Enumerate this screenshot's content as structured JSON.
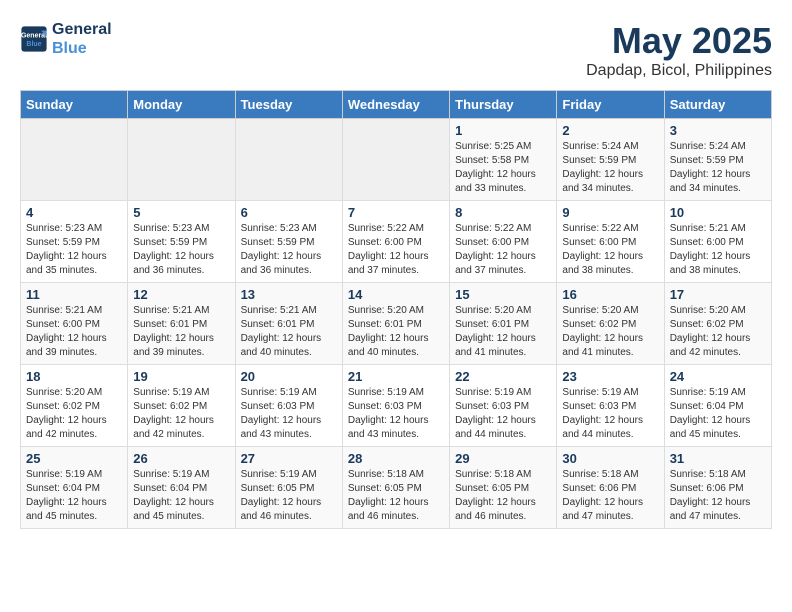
{
  "header": {
    "logo_line1": "General",
    "logo_line2": "Blue",
    "title": "May 2025",
    "subtitle": "Dapdap, Bicol, Philippines"
  },
  "weekdays": [
    "Sunday",
    "Monday",
    "Tuesday",
    "Wednesday",
    "Thursday",
    "Friday",
    "Saturday"
  ],
  "weeks": [
    [
      {
        "day": "",
        "info": ""
      },
      {
        "day": "",
        "info": ""
      },
      {
        "day": "",
        "info": ""
      },
      {
        "day": "",
        "info": ""
      },
      {
        "day": "1",
        "info": "Sunrise: 5:25 AM\nSunset: 5:58 PM\nDaylight: 12 hours\nand 33 minutes."
      },
      {
        "day": "2",
        "info": "Sunrise: 5:24 AM\nSunset: 5:59 PM\nDaylight: 12 hours\nand 34 minutes."
      },
      {
        "day": "3",
        "info": "Sunrise: 5:24 AM\nSunset: 5:59 PM\nDaylight: 12 hours\nand 34 minutes."
      }
    ],
    [
      {
        "day": "4",
        "info": "Sunrise: 5:23 AM\nSunset: 5:59 PM\nDaylight: 12 hours\nand 35 minutes."
      },
      {
        "day": "5",
        "info": "Sunrise: 5:23 AM\nSunset: 5:59 PM\nDaylight: 12 hours\nand 36 minutes."
      },
      {
        "day": "6",
        "info": "Sunrise: 5:23 AM\nSunset: 5:59 PM\nDaylight: 12 hours\nand 36 minutes."
      },
      {
        "day": "7",
        "info": "Sunrise: 5:22 AM\nSunset: 6:00 PM\nDaylight: 12 hours\nand 37 minutes."
      },
      {
        "day": "8",
        "info": "Sunrise: 5:22 AM\nSunset: 6:00 PM\nDaylight: 12 hours\nand 37 minutes."
      },
      {
        "day": "9",
        "info": "Sunrise: 5:22 AM\nSunset: 6:00 PM\nDaylight: 12 hours\nand 38 minutes."
      },
      {
        "day": "10",
        "info": "Sunrise: 5:21 AM\nSunset: 6:00 PM\nDaylight: 12 hours\nand 38 minutes."
      }
    ],
    [
      {
        "day": "11",
        "info": "Sunrise: 5:21 AM\nSunset: 6:00 PM\nDaylight: 12 hours\nand 39 minutes."
      },
      {
        "day": "12",
        "info": "Sunrise: 5:21 AM\nSunset: 6:01 PM\nDaylight: 12 hours\nand 39 minutes."
      },
      {
        "day": "13",
        "info": "Sunrise: 5:21 AM\nSunset: 6:01 PM\nDaylight: 12 hours\nand 40 minutes."
      },
      {
        "day": "14",
        "info": "Sunrise: 5:20 AM\nSunset: 6:01 PM\nDaylight: 12 hours\nand 40 minutes."
      },
      {
        "day": "15",
        "info": "Sunrise: 5:20 AM\nSunset: 6:01 PM\nDaylight: 12 hours\nand 41 minutes."
      },
      {
        "day": "16",
        "info": "Sunrise: 5:20 AM\nSunset: 6:02 PM\nDaylight: 12 hours\nand 41 minutes."
      },
      {
        "day": "17",
        "info": "Sunrise: 5:20 AM\nSunset: 6:02 PM\nDaylight: 12 hours\nand 42 minutes."
      }
    ],
    [
      {
        "day": "18",
        "info": "Sunrise: 5:20 AM\nSunset: 6:02 PM\nDaylight: 12 hours\nand 42 minutes."
      },
      {
        "day": "19",
        "info": "Sunrise: 5:19 AM\nSunset: 6:02 PM\nDaylight: 12 hours\nand 42 minutes."
      },
      {
        "day": "20",
        "info": "Sunrise: 5:19 AM\nSunset: 6:03 PM\nDaylight: 12 hours\nand 43 minutes."
      },
      {
        "day": "21",
        "info": "Sunrise: 5:19 AM\nSunset: 6:03 PM\nDaylight: 12 hours\nand 43 minutes."
      },
      {
        "day": "22",
        "info": "Sunrise: 5:19 AM\nSunset: 6:03 PM\nDaylight: 12 hours\nand 44 minutes."
      },
      {
        "day": "23",
        "info": "Sunrise: 5:19 AM\nSunset: 6:03 PM\nDaylight: 12 hours\nand 44 minutes."
      },
      {
        "day": "24",
        "info": "Sunrise: 5:19 AM\nSunset: 6:04 PM\nDaylight: 12 hours\nand 45 minutes."
      }
    ],
    [
      {
        "day": "25",
        "info": "Sunrise: 5:19 AM\nSunset: 6:04 PM\nDaylight: 12 hours\nand 45 minutes."
      },
      {
        "day": "26",
        "info": "Sunrise: 5:19 AM\nSunset: 6:04 PM\nDaylight: 12 hours\nand 45 minutes."
      },
      {
        "day": "27",
        "info": "Sunrise: 5:19 AM\nSunset: 6:05 PM\nDaylight: 12 hours\nand 46 minutes."
      },
      {
        "day": "28",
        "info": "Sunrise: 5:18 AM\nSunset: 6:05 PM\nDaylight: 12 hours\nand 46 minutes."
      },
      {
        "day": "29",
        "info": "Sunrise: 5:18 AM\nSunset: 6:05 PM\nDaylight: 12 hours\nand 46 minutes."
      },
      {
        "day": "30",
        "info": "Sunrise: 5:18 AM\nSunset: 6:06 PM\nDaylight: 12 hours\nand 47 minutes."
      },
      {
        "day": "31",
        "info": "Sunrise: 5:18 AM\nSunset: 6:06 PM\nDaylight: 12 hours\nand 47 minutes."
      }
    ]
  ]
}
